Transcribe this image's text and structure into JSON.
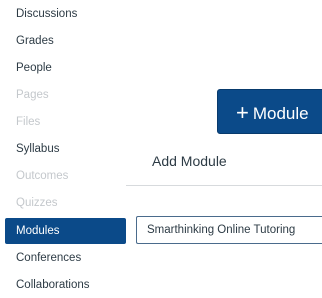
{
  "nav": {
    "items": [
      {
        "label": "Discussions",
        "state": "normal"
      },
      {
        "label": "Grades",
        "state": "normal"
      },
      {
        "label": "People",
        "state": "normal"
      },
      {
        "label": "Pages",
        "state": "disabled"
      },
      {
        "label": "Files",
        "state": "disabled"
      },
      {
        "label": "Syllabus",
        "state": "normal"
      },
      {
        "label": "Outcomes",
        "state": "disabled"
      },
      {
        "label": "Quizzes",
        "state": "disabled"
      },
      {
        "label": "Modules",
        "state": "active"
      },
      {
        "label": "Conferences",
        "state": "normal"
      },
      {
        "label": "Collaborations",
        "state": "normal"
      }
    ]
  },
  "toolbar": {
    "add_module_icon": "+",
    "add_module_label": "Module"
  },
  "dialog": {
    "title": "Add Module",
    "module_name_value": "Smarthinking Online Tutoring"
  },
  "colors": {
    "accent": "#0b4a89",
    "disabled_text": "#c4c8cc",
    "text": "#2d3b45"
  }
}
